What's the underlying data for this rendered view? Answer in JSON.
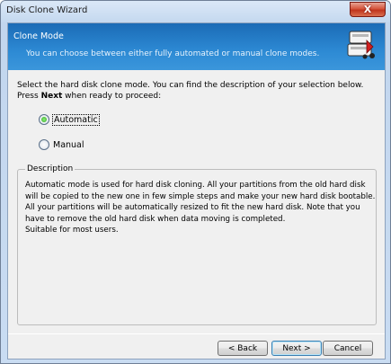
{
  "window": {
    "title": "Disk Clone Wizard",
    "close_label": "X"
  },
  "header": {
    "title": "Clone Mode",
    "subtitle": "You can choose between either fully automated or manual clone modes.",
    "icon": "disk-clone-icon"
  },
  "intro": {
    "text_before": "Select the hard disk clone mode. You can find the description of your selection below. Press ",
    "bold": "Next",
    "text_after": " when ready to proceed:"
  },
  "options": [
    {
      "label": "Automatic",
      "selected": true
    },
    {
      "label": "Manual",
      "selected": false
    }
  ],
  "description": {
    "legend": "Description",
    "text": "Automatic mode is used for hard disk cloning. All your partitions from the old hard disk will be copied to the new one in few simple steps and make your new hard disk bootable. All your partitions will be automatically resized to fit the new hard disk. Note that you have to remove the old hard disk when data moving is completed.",
    "note": "Suitable for most users."
  },
  "buttons": {
    "back": "< Back",
    "next": "Next >",
    "cancel": "Cancel"
  },
  "colors": {
    "header": "#2d8ad4",
    "close": "#c0351d",
    "radio_selected": "#2ea51f"
  }
}
